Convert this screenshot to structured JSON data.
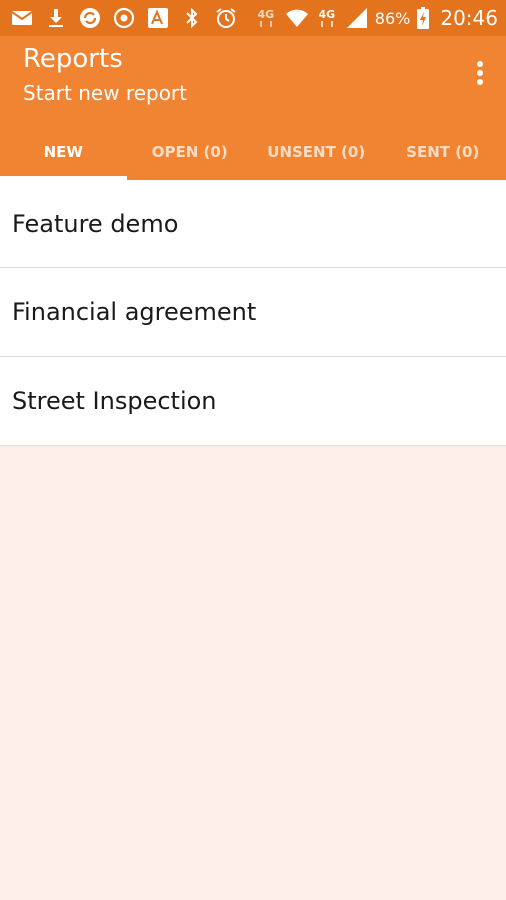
{
  "status_bar": {
    "icons": [
      "mail-icon",
      "download-icon",
      "sync-icon",
      "record-icon",
      "font-icon",
      "bluetooth-icon",
      "alarm-icon",
      "wifi-4g-icon",
      "wifi-icon",
      "lte-4g-icon",
      "signal-icon",
      "battery-icon"
    ],
    "net_label_1": "4G",
    "net_label_2": "4G",
    "battery_percent": "86%",
    "time": "20:46"
  },
  "app_bar": {
    "title": "Reports",
    "subtitle": "Start new report",
    "overflow_icon": "more-vert-icon",
    "color": "#f08432",
    "status_color": "#e3731d"
  },
  "tabs": [
    {
      "label": "NEW",
      "active": true
    },
    {
      "label": "OPEN (0)",
      "active": false
    },
    {
      "label": "UNSENT (0)",
      "active": false
    },
    {
      "label": "SENT (0)",
      "active": false
    }
  ],
  "reports": [
    {
      "label": "Feature demo"
    },
    {
      "label": "Financial agreement"
    },
    {
      "label": "Street Inspection"
    }
  ],
  "background_color": "#fdf0eb"
}
